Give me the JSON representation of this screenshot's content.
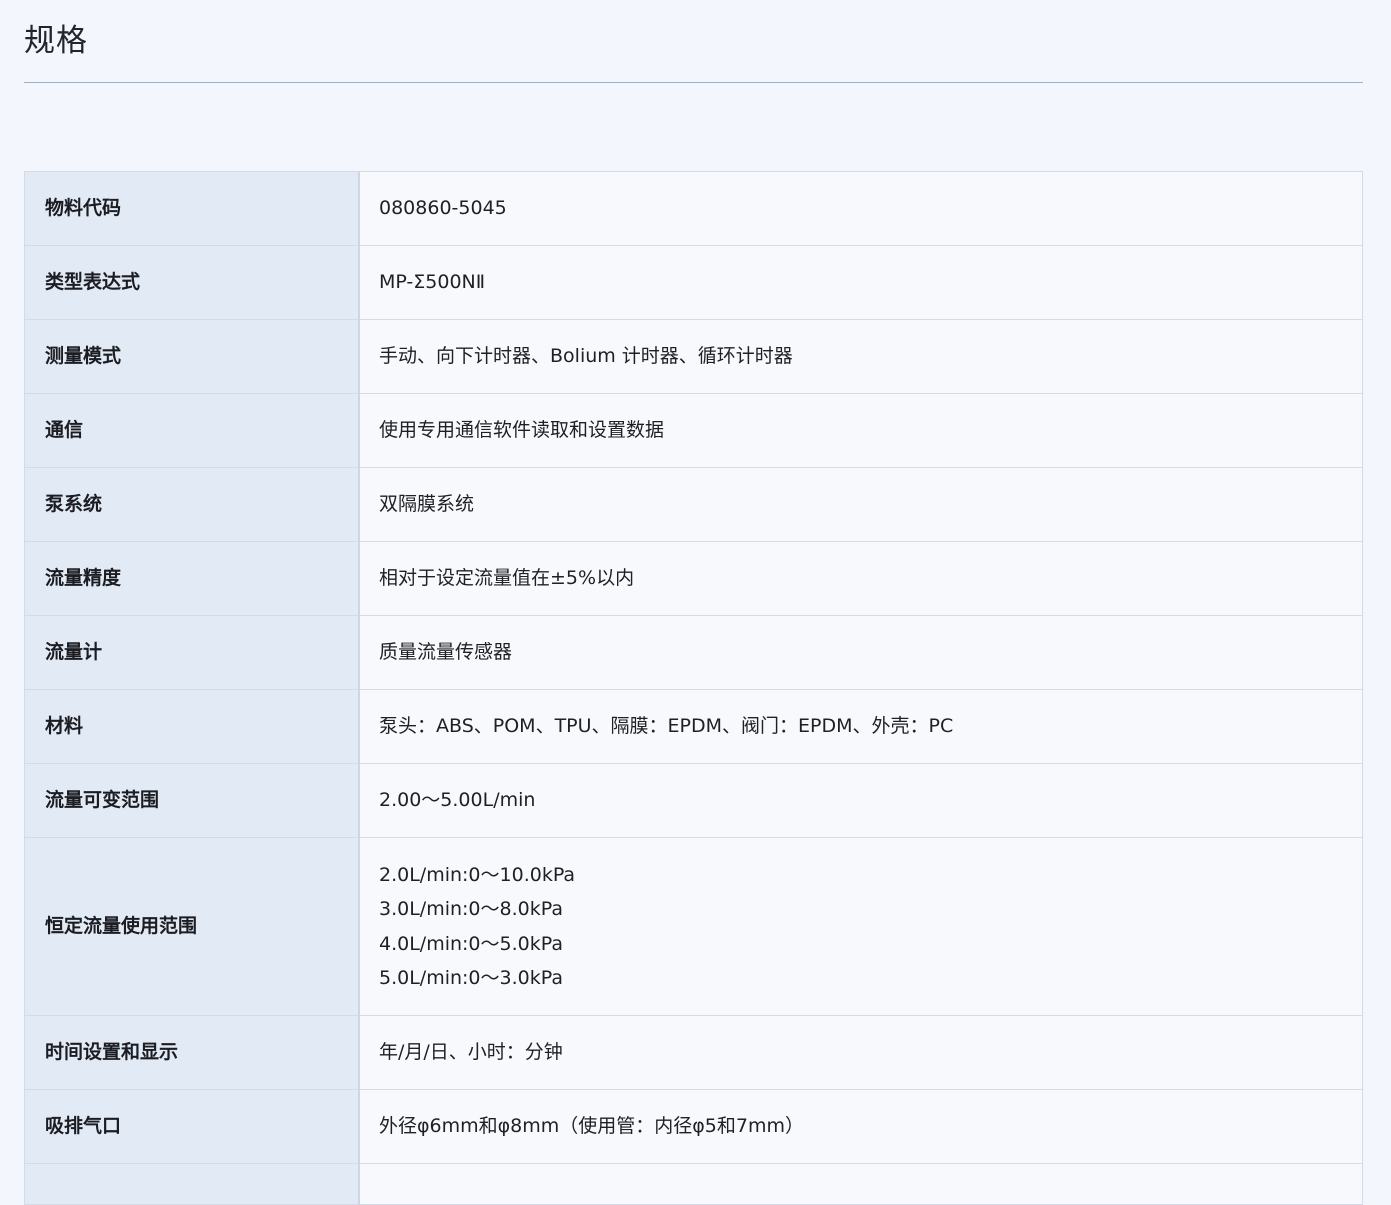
{
  "page": {
    "title": "规格"
  },
  "spec": {
    "rows": [
      {
        "label": "物料代码",
        "value": "080860-5045"
      },
      {
        "label": "类型表达式",
        "value": "MP-Σ500NⅡ"
      },
      {
        "label": "测量模式",
        "value": "手动、向下计时器、Bolium 计时器、循环计时器"
      },
      {
        "label": "通信",
        "value": "使用专用通信软件读取和设置数据"
      },
      {
        "label": "泵系统",
        "value": "双隔膜系统"
      },
      {
        "label": "流量精度",
        "value": "相对于设定流量值在±5%以内"
      },
      {
        "label": "流量计",
        "value": "质量流量传感器"
      },
      {
        "label": "材料",
        "value": "泵头：ABS、POM、TPU、隔膜：EPDM、阀门：EPDM、外壳：PC"
      },
      {
        "label": "流量可变范围",
        "value": "2.00～5.00L/min"
      },
      {
        "label": "恒定流量使用范围",
        "lines": [
          "2.0L/min:0～10.0kPa",
          "3.0L/min:0～8.0kPa",
          "4.0L/min:0～5.0kPa",
          "5.0L/min:0～3.0kPa"
        ]
      },
      {
        "label": "时间设置和显示",
        "value": "年/月/日、小时：分钟"
      },
      {
        "label": "吸排气口",
        "value": "外径φ6mm和φ8mm（使用管：内径φ5和7mm）"
      }
    ]
  }
}
